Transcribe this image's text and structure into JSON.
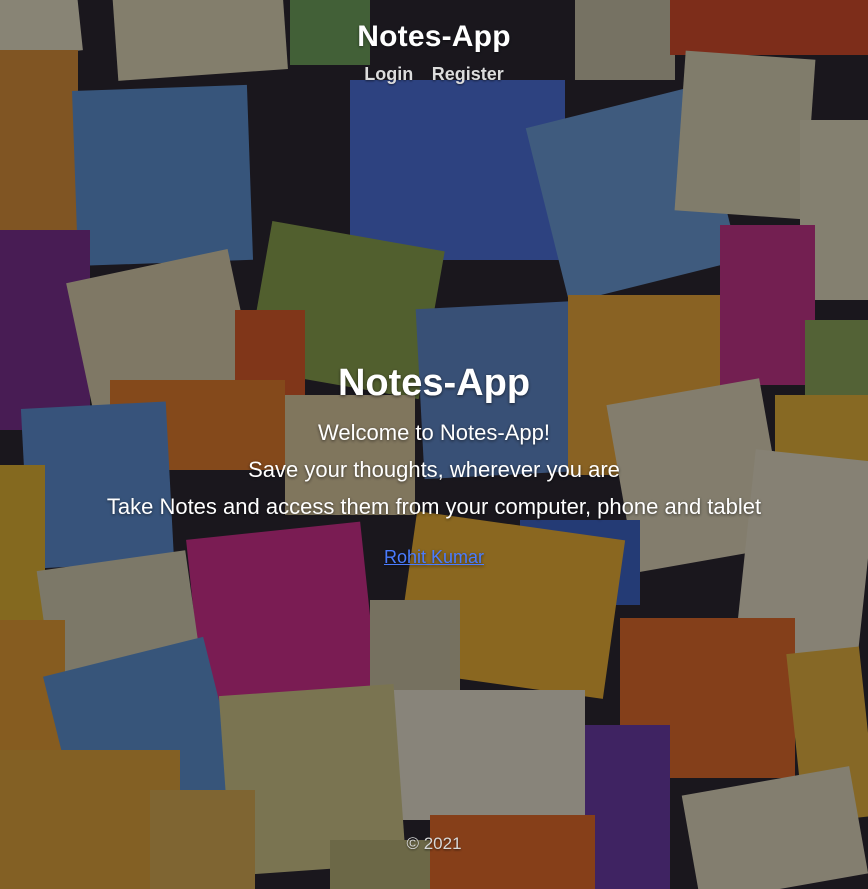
{
  "header": {
    "brand": "Notes-App",
    "nav": {
      "login": "Login",
      "register": "Register"
    }
  },
  "hero": {
    "title": "Notes-App",
    "lines": [
      "Welcome to Notes-App!",
      "Save your thoughts, wherever you are",
      "Take Notes and access them from your computer, phone and tablet"
    ],
    "author_link": "Rohit Kumar"
  },
  "footer": {
    "copyright": "© 2021"
  },
  "colors": {
    "link": "#4a7cff",
    "text": "#ffffff",
    "nav_text": "#dcdcdc"
  }
}
